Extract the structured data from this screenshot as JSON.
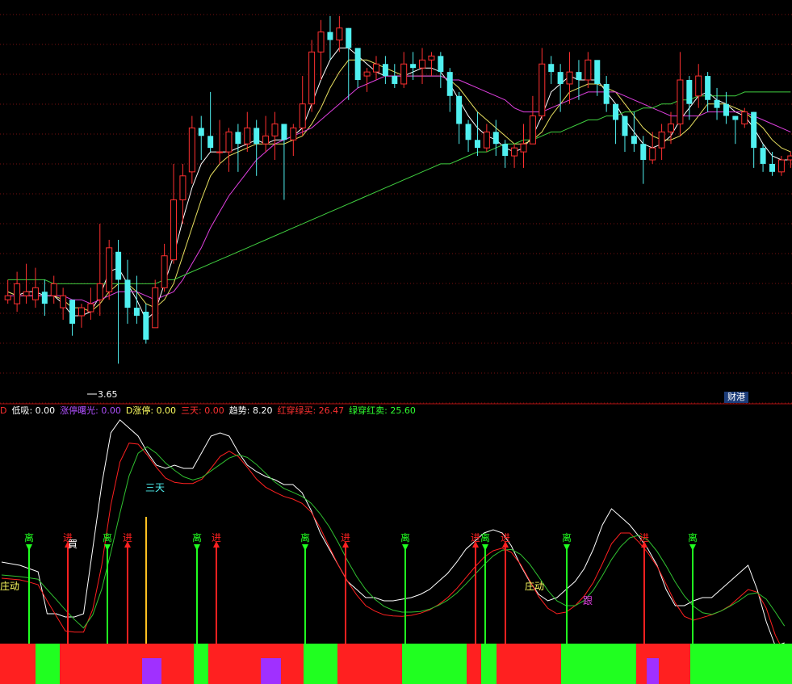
{
  "badge": "财港",
  "price_marker": "3.65",
  "legend": [
    {
      "label": "D",
      "value": "",
      "color": "#ff3030"
    },
    {
      "label": "低吸:",
      "value": "0.00",
      "color": "#ffffff"
    },
    {
      "label": "涨停曙光:",
      "value": "0.00",
      "color": "#b050ff"
    },
    {
      "label": "D涨停:",
      "value": "0.00",
      "color": "#ffff60"
    },
    {
      "label": "三天:",
      "value": "0.00",
      "color": "#ff3030"
    },
    {
      "label": "趋势:",
      "value": "8.20",
      "color": "#ffffff"
    },
    {
      "label": "红穿绿买:",
      "value": "26.47",
      "color": "#ff3030"
    },
    {
      "label": "绿穿红卖:",
      "value": "25.60",
      "color": "#30ff30"
    }
  ],
  "annotations": {
    "santian": "三天",
    "zhuangdong_left": "庄动",
    "zhuangdong_mid": "庄动",
    "gen": "跟",
    "mai": "買"
  },
  "colors": {
    "up": "#ff3030",
    "down": "#50f0f0",
    "ma_white": "#ffffff",
    "ma_yellow": "#e8e060",
    "ma_magenta": "#e040e0",
    "ma_green": "#40d040",
    "grid": "#7a1010",
    "buy": "#ff2020",
    "sell": "#20ff20",
    "purple": "#a030ff"
  },
  "chart_data": {
    "type": "candlestick",
    "candles": [
      [
        1,
        2,
        6,
        0
      ],
      [
        0,
        5,
        8,
        -2
      ],
      [
        2,
        3,
        10,
        0
      ],
      [
        1,
        4,
        9,
        -1
      ],
      [
        3,
        0,
        6,
        -3
      ],
      [
        2,
        5,
        7,
        0
      ],
      [
        -1,
        2,
        4,
        -4
      ],
      [
        1,
        -5,
        1,
        -8
      ],
      [
        -3,
        -1,
        0,
        -6
      ],
      [
        -2,
        0,
        4,
        -4
      ],
      [
        1,
        5,
        20,
        -3
      ],
      [
        3,
        14,
        16,
        1
      ],
      [
        13,
        6,
        16,
        -15
      ],
      [
        6,
        -1,
        11,
        -5
      ],
      [
        -1,
        -3,
        7,
        -5
      ],
      [
        -2,
        -9,
        0,
        -10
      ],
      [
        -6,
        4,
        6,
        -6
      ],
      [
        4,
        12,
        15,
        3
      ],
      [
        11,
        26,
        35,
        10
      ],
      [
        26,
        32,
        35,
        20
      ],
      [
        33,
        44,
        47,
        30
      ],
      [
        44,
        42,
        47,
        36
      ],
      [
        42,
        39,
        53,
        38
      ],
      [
        38,
        38,
        46,
        35
      ],
      [
        38,
        43,
        44,
        33
      ],
      [
        43,
        40,
        45,
        33
      ],
      [
        40,
        44,
        48,
        38
      ],
      [
        44,
        40,
        46,
        32
      ],
      [
        40,
        42,
        47,
        38
      ],
      [
        42,
        45,
        48,
        36
      ],
      [
        45,
        41,
        45,
        26
      ],
      [
        41,
        44,
        45,
        37
      ],
      [
        44,
        50,
        57,
        42
      ],
      [
        50,
        63,
        66,
        48
      ],
      [
        63,
        68,
        71,
        56
      ],
      [
        68,
        66,
        72,
        61
      ],
      [
        66,
        69,
        72,
        63
      ],
      [
        69,
        64,
        69,
        51
      ],
      [
        64,
        56,
        61,
        54
      ],
      [
        57,
        58,
        59,
        53
      ],
      [
        58,
        60,
        62,
        56
      ],
      [
        60,
        57,
        62,
        55
      ],
      [
        57,
        55,
        60,
        54
      ],
      [
        55,
        60,
        63,
        54
      ],
      [
        60,
        59,
        63,
        56
      ],
      [
        59,
        61,
        64,
        55
      ],
      [
        61,
        62,
        63,
        57
      ],
      [
        62,
        58,
        63,
        54
      ],
      [
        58,
        52,
        59,
        48
      ],
      [
        52,
        45,
        53,
        40
      ],
      [
        45,
        41,
        46,
        38
      ],
      [
        41,
        39,
        48,
        37
      ],
      [
        39,
        43,
        45,
        38
      ],
      [
        43,
        40,
        46,
        37
      ],
      [
        40,
        37,
        41,
        34
      ],
      [
        37,
        39,
        40,
        34
      ],
      [
        38,
        40,
        45,
        34
      ],
      [
        40,
        47,
        52,
        40
      ],
      [
        47,
        60,
        64,
        46
      ],
      [
        60,
        58,
        62,
        55
      ],
      [
        58,
        55,
        60,
        48
      ],
      [
        55,
        58,
        63,
        50
      ],
      [
        58,
        56,
        61,
        51
      ],
      [
        56,
        61,
        63,
        54
      ],
      [
        61,
        55,
        60,
        52
      ],
      [
        55,
        50,
        57,
        48
      ],
      [
        50,
        46,
        50,
        40
      ],
      [
        47,
        42,
        47,
        38
      ],
      [
        42,
        40,
        48,
        38
      ],
      [
        40,
        36,
        42,
        30
      ],
      [
        36,
        39,
        43,
        35
      ],
      [
        39,
        43,
        45,
        36
      ],
      [
        43,
        45,
        48,
        40
      ],
      [
        45,
        56,
        63,
        42
      ],
      [
        56,
        50,
        57,
        46
      ],
      [
        52,
        57,
        60,
        49
      ],
      [
        57,
        51,
        58,
        48
      ],
      [
        51,
        49,
        54,
        46
      ],
      [
        50,
        47,
        53,
        45
      ],
      [
        47,
        46,
        47,
        40
      ],
      [
        45,
        48,
        49,
        44
      ],
      [
        48,
        39,
        48,
        34
      ],
      [
        39,
        35,
        40,
        33
      ],
      [
        35,
        33,
        38,
        32
      ],
      [
        33,
        36,
        37,
        32
      ],
      [
        36,
        37,
        38,
        34
      ]
    ],
    "ma": [
      {
        "color": "white",
        "values": [
          3,
          2,
          3,
          3,
          2,
          2,
          0,
          -3,
          -3,
          -2,
          2,
          8,
          9,
          5,
          1,
          -4,
          -2,
          5,
          12,
          21,
          29,
          35,
          38,
          38,
          38,
          39,
          40,
          41,
          40,
          41,
          41,
          42,
          44,
          50,
          56,
          61,
          64,
          64,
          62,
          60,
          58,
          57,
          57,
          57,
          58,
          59,
          59,
          58,
          55,
          51,
          47,
          44,
          42,
          41,
          39,
          38,
          39,
          42,
          47,
          53,
          55,
          57,
          56,
          56,
          56,
          53,
          50,
          46,
          43,
          40,
          39,
          40,
          42,
          46,
          49,
          52,
          53,
          51,
          50,
          48,
          47,
          44,
          40,
          37,
          36,
          36
        ]
      },
      {
        "color": "yellow",
        "values": [
          3,
          2,
          2,
          2,
          2,
          2,
          1,
          -1,
          -1,
          -2,
          0,
          3,
          5,
          5,
          3,
          0,
          -1,
          1,
          5,
          12,
          19,
          26,
          32,
          35,
          37,
          38,
          39,
          40,
          40,
          40,
          40,
          41,
          42,
          45,
          49,
          54,
          58,
          61,
          61,
          61,
          60,
          59,
          58,
          57,
          57,
          57,
          57,
          57,
          56,
          54,
          51,
          48,
          46,
          44,
          42,
          40,
          40,
          41,
          43,
          47,
          50,
          53,
          54,
          55,
          55,
          54,
          53,
          50,
          47,
          44,
          42,
          41,
          41,
          42,
          44,
          47,
          50,
          50,
          50,
          49,
          48,
          46,
          44,
          41,
          39,
          38
        ]
      },
      {
        "color": "magenta",
        "values": [
          2,
          2,
          2,
          2,
          2,
          2,
          2,
          1,
          1,
          0,
          1,
          2,
          3,
          3,
          3,
          2,
          1,
          2,
          3,
          6,
          10,
          14,
          19,
          23,
          27,
          30,
          33,
          36,
          38,
          40,
          41,
          42,
          43,
          44,
          46,
          48,
          50,
          52,
          54,
          55,
          56,
          57,
          57,
          57,
          57,
          57,
          57,
          57,
          56,
          56,
          55,
          54,
          53,
          52,
          51,
          49,
          48,
          48,
          48,
          49,
          50,
          51,
          52,
          53,
          53,
          53,
          53,
          52,
          51,
          50,
          49,
          48,
          47,
          47,
          47,
          47,
          48,
          48,
          48,
          48,
          48,
          47,
          46,
          45,
          44,
          43
        ]
      },
      {
        "color": "green",
        "values": [
          6,
          6,
          6,
          6,
          6,
          5,
          5,
          5,
          5,
          5,
          5,
          5,
          5,
          5,
          5,
          5,
          5,
          6,
          6,
          7,
          8,
          9,
          10,
          11,
          12,
          13,
          14,
          15,
          16,
          17,
          18,
          19,
          20,
          21,
          22,
          23,
          24,
          25,
          26,
          27,
          28,
          29,
          30,
          31,
          32,
          33,
          34,
          35,
          35,
          36,
          37,
          38,
          38,
          39,
          40,
          40,
          41,
          41,
          42,
          43,
          43,
          44,
          45,
          46,
          46,
          47,
          47,
          48,
          48,
          49,
          49,
          50,
          50,
          51,
          51,
          52,
          52,
          52,
          52,
          52,
          53,
          53,
          53,
          53,
          53,
          53
        ]
      }
    ],
    "indicator": {
      "white": [
        12,
        11,
        10,
        8,
        6,
        -20,
        -20,
        -22,
        -22,
        -20,
        20,
        60,
        92,
        100,
        95,
        90,
        80,
        72,
        70,
        72,
        70,
        70,
        80,
        90,
        92,
        90,
        80,
        72,
        68,
        65,
        63,
        60,
        60,
        55,
        44,
        30,
        20,
        10,
        0,
        -5,
        -10,
        -10,
        -12,
        -12,
        -11,
        -10,
        -8,
        -5,
        0,
        5,
        12,
        20,
        25,
        30,
        32,
        30,
        22,
        10,
        0,
        -8,
        -12,
        -10,
        -5,
        0,
        8,
        20,
        35,
        45,
        40,
        35,
        28,
        20,
        10,
        -5,
        -15,
        -15,
        -12,
        -10,
        -10,
        -5,
        0,
        5,
        10,
        -5,
        -25,
        -40,
        -38
      ]
    },
    "y_scale": "price",
    "price_label": "3.65"
  }
}
